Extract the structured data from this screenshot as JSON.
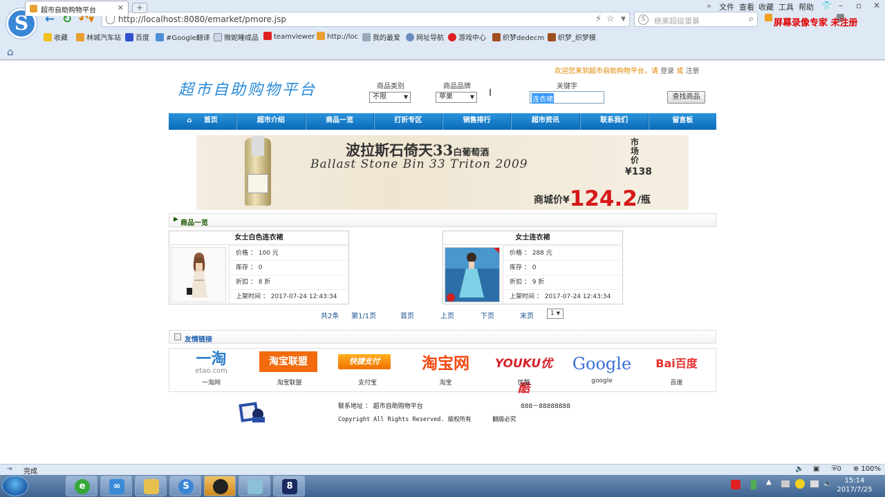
{
  "browser": {
    "url": "http://localhost:8080/emarket/pmore.jsp",
    "search_placeholder": "绝美超级雷暴",
    "menu": [
      "文件",
      "查看",
      "收藏",
      "工具",
      "帮助"
    ],
    "recorder_text": "屏幕录像专家 未注册",
    "bookmarks": [
      "收藏",
      "林城汽车站",
      "百度",
      "#Google翻译",
      "微妮睡成品",
      "teamviewer",
      "http://loc",
      "我的最爱",
      "网址导航",
      "游戏中心",
      "织梦dedecm",
      "织梦_织梦模"
    ],
    "tab_title": "超市自助购物平台",
    "status_text": "完成",
    "zoom": "100%",
    "tray_badge": "0"
  },
  "header": {
    "welcome": "欢迎您来到超市自助购物平台，请",
    "login": "登录",
    "or": "或",
    "register": "注册",
    "logo_text": "超市自助购物平台"
  },
  "search": {
    "category_label": "商品类别",
    "category_value": "不限",
    "brand_label": "商品品牌",
    "brand_value": "苹果",
    "keyword_label": "关键字",
    "keyword_value": "连衣裙",
    "button": "查找商品"
  },
  "nav": [
    "首页",
    "超市介绍",
    "商品一览",
    "打折专区",
    "销售排行",
    "超市资讯",
    "联系我们",
    "留言板"
  ],
  "banner": {
    "title": "波拉斯石倚天33",
    "title_small": "白葡萄酒",
    "subtitle": "Ballast Stone Bin 33 Triton 2009",
    "market_label": "市场价",
    "market_price": "¥138",
    "mall_label": "商城价¥",
    "mall_price": "124.2",
    "unit": "/瓶"
  },
  "products_section": {
    "title": "商品一览",
    "items": [
      {
        "name": "女士白色连衣裙",
        "price": "价格 ： 100 元",
        "stock": "库存 ： 0",
        "discount": "折扣 ： 8 折",
        "time": "上架时间 ： 2017-07-24 12:43:34"
      },
      {
        "name": "女士连衣裙",
        "price": "价格 ： 288 元",
        "stock": "库存 ： 0",
        "discount": "折扣 ： 9 折",
        "time": "上架时间 ： 2017-07-24 12:43:34"
      }
    ]
  },
  "pagination": {
    "total": "共2条",
    "page": "第1/1页",
    "first": "首页",
    "prev": "上页",
    "next": "下页",
    "last": "末页",
    "select": "1"
  },
  "links_section": {
    "title": "友情链接",
    "items": [
      {
        "logo": "一淘",
        "logo_sub": "etao.com",
        "name": "一淘网"
      },
      {
        "logo": "淘宝联盟",
        "name": "淘宝联盟"
      },
      {
        "logo": "快捷支付",
        "name": "支付宝"
      },
      {
        "logo": "淘宝网",
        "name": "淘宝"
      },
      {
        "logo": "YOUKU优酷",
        "name": "优酷"
      },
      {
        "logo": "Google",
        "name": "google"
      },
      {
        "logo": "Bai百度",
        "name": "百度"
      }
    ]
  },
  "footer": {
    "address": "联系地址 ： 超市自助购物平台",
    "phone": "888－88888888",
    "copyright": "Copyright All Rights Reserved. 版权所有",
    "rights": "翻版必究"
  },
  "clock": {
    "time": "15:14",
    "date": "2017/7/25"
  },
  "colors": {
    "nav_blue": "#0b6ab8",
    "logo_blue": "#2a8bd8",
    "price_red": "#d61818",
    "welcome_orange": "#e08600"
  }
}
